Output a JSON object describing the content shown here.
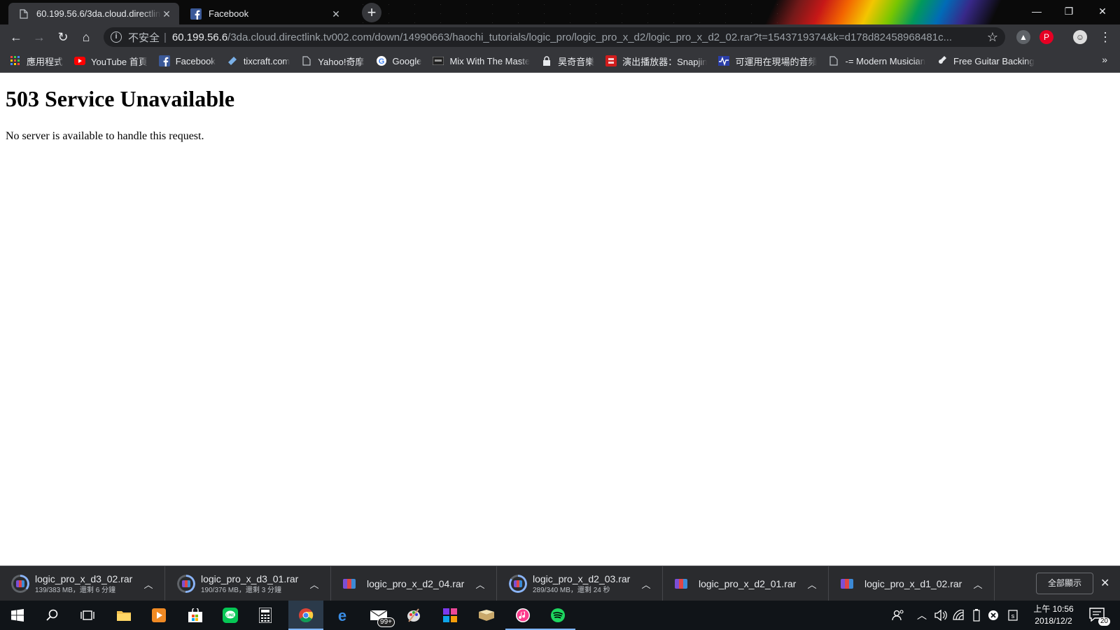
{
  "tabs": [
    {
      "title": "60.199.56.6/3da.cloud.directlin",
      "favicon": "page-icon",
      "active": true
    },
    {
      "title": "Facebook",
      "favicon": "facebook-icon",
      "active": false
    }
  ],
  "omnibox": {
    "security_label": "不安全",
    "separator": "|",
    "host": "60.199.56.6",
    "path": "/3da.cloud.directlink.tv002.com/down/14990663/haochi_tutorials/logic_pro/logic_pro_x_d2/logic_pro_x_d2_02.rar?t=1543719374&k=d178d82458968481c..."
  },
  "bookmarks": [
    {
      "label": "應用程式",
      "icon": "apps-grid-icon"
    },
    {
      "label": "YouTube 首頁",
      "icon": "youtube-icon"
    },
    {
      "label": "Facebook",
      "icon": "facebook-icon"
    },
    {
      "label": "tixcraft.com",
      "icon": "tixcraft-icon"
    },
    {
      "label": "Yahoo!奇摩",
      "icon": "page-icon"
    },
    {
      "label": "Google",
      "icon": "google-icon"
    },
    {
      "label": "Mix With The Maste",
      "icon": "mwtm-icon"
    },
    {
      "label": "昊奇音樂",
      "icon": "lock-icon"
    },
    {
      "label": "演出播放器：Snapjin",
      "icon": "snapjin-icon"
    },
    {
      "label": "可運用在現場的音頻",
      "icon": "waveform-icon"
    },
    {
      "label": "-= Modern Musician",
      "icon": "page-icon"
    },
    {
      "label": "Free Guitar Backing",
      "icon": "guitar-icon"
    }
  ],
  "bookmarks_overflow": "»",
  "page": {
    "heading": "503 Service Unavailable",
    "message": "No server is available to handle this request."
  },
  "downloads": [
    {
      "filename": "logic_pro_x_d3_02.rar",
      "status": "139/383 MB，還剩 6 分鐘",
      "in_progress": true,
      "progress": 0.36
    },
    {
      "filename": "logic_pro_x_d3_01.rar",
      "status": "190/376 MB，還剩 3 分鐘",
      "in_progress": true,
      "progress": 0.51
    },
    {
      "filename": "logic_pro_x_d2_04.rar",
      "status": "",
      "in_progress": false
    },
    {
      "filename": "logic_pro_x_d2_03.rar",
      "status": "289/340 MB，還剩 24 秒",
      "in_progress": true,
      "progress": 0.85
    },
    {
      "filename": "logic_pro_x_d2_01.rar",
      "status": "",
      "in_progress": false
    },
    {
      "filename": "logic_pro_x_d1_02.rar",
      "status": "",
      "in_progress": false
    }
  ],
  "show_all_label": "全部顯示",
  "taskbar": {
    "badge": "99+",
    "clock_time": "上午 10:56",
    "clock_date": "2018/12/2",
    "notification_count": "20"
  },
  "colors": {
    "tabstrip": "#0a0a0a",
    "toolbar": "#35363a",
    "omnibox": "#202124",
    "shelf": "#2a2b2e",
    "taskbar": "#101418",
    "progress_ring": "#8ab4f8"
  }
}
